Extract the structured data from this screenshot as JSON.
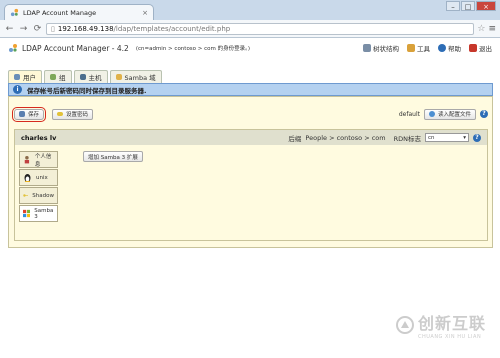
{
  "browser": {
    "tab_title": "LDAP Account Manage",
    "url_host": "192.168.49.138",
    "url_path": "/ldap/templates/account/edit.php"
  },
  "app": {
    "title": "LDAP Account Manager - 4.2",
    "subtitle": "(cn=admin > contoso > com 的身份登录。)",
    "links": {
      "tree": "树状结构",
      "tools": "工具",
      "help": "帮助",
      "logout": "退出"
    }
  },
  "tabs": [
    {
      "label": "用户"
    },
    {
      "label": "组"
    },
    {
      "label": "主机"
    },
    {
      "label": "Samba 域"
    }
  ],
  "notice": "保存帐号后新密码同时保存到目录服务器.",
  "actions": {
    "save": "保存",
    "set_password": "设置密码",
    "profile_label": "default",
    "load_profile": "读入配置文件"
  },
  "account": {
    "name": "charles lv",
    "suffix_label": "后缀",
    "suffix_value": "People > contoso > com",
    "rdn_label": "RDN标志",
    "rdn_value": "cn"
  },
  "modules": [
    {
      "label": "个人信息",
      "icon": "person-icon"
    },
    {
      "label": "unix",
      "icon": "tux-icon"
    },
    {
      "label": "Shadow",
      "icon": "key-icon"
    },
    {
      "label": "Samba 3",
      "icon": "windows-icon"
    }
  ],
  "module_action": "增加 Samba 3 扩展",
  "watermark": {
    "cn": "创新互联",
    "en": "CHUANG XIN HU LIAN"
  }
}
